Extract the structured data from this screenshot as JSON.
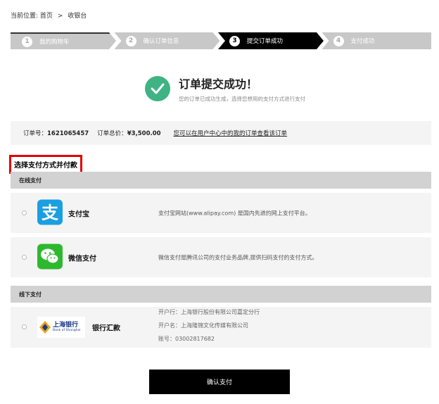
{
  "breadcrumb": {
    "prefix": "当前位置:",
    "home": "首页",
    "separator": ">",
    "current": "收银台"
  },
  "steps": [
    {
      "num": "1",
      "label": "我的购物车",
      "state": "done"
    },
    {
      "num": "2",
      "label": "确认订单信息",
      "state": "done"
    },
    {
      "num": "3",
      "label": "提交订单成功",
      "state": "active"
    },
    {
      "num": "4",
      "label": "支付成功",
      "state": "pending"
    }
  ],
  "success": {
    "title": "订单提交成功！",
    "subtitle": "您的订单已成功生成，选择您想用的支付方式进行支付",
    "icon": "check-icon",
    "color": "#3fb384"
  },
  "order": {
    "number_label": "订单号：",
    "number": "1621065457",
    "total_label": "订单总价：",
    "total": "¥3,500.00",
    "link": "您可以在用户中心中的我的订单查看该订单"
  },
  "section_title": "选择支付方式并付款",
  "online": {
    "header": "在线支付",
    "methods": [
      {
        "name": "支付宝",
        "icon": "alipay-icon",
        "desc": "支付宝网站(www.alipay.com) 是国内先进的网上支付平台。",
        "color": "#1a9fe0"
      },
      {
        "name": "微信支付",
        "icon": "wechat-icon",
        "desc": "微信支付是腾讯公司的支付业务品牌,提供扫码支付的支付方式。",
        "color": "#2eb82e"
      }
    ]
  },
  "offline": {
    "header": "线下支付",
    "bank": {
      "logo_cn": "上海银行",
      "logo_en": "Bank of Shanghai",
      "name": "银行汇款",
      "lines": [
        "开户行：上海银行股份有限公司嘉定分行",
        "开户名：上海隆锦文化传媒有限公司",
        "账号：03002817682"
      ]
    }
  },
  "confirm_button": "确认支付"
}
